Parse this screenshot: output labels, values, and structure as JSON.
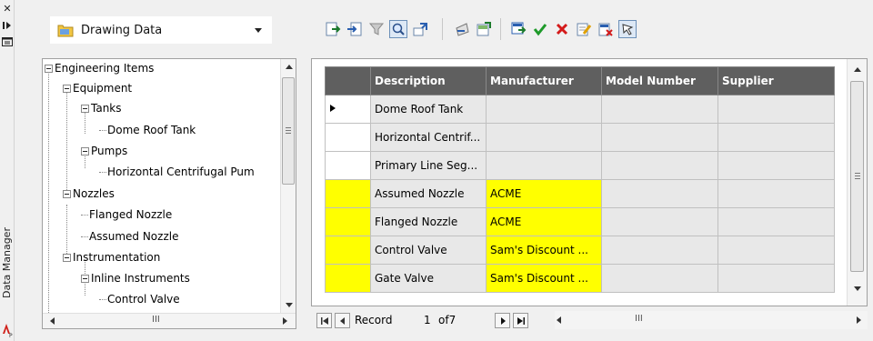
{
  "palette": {
    "header_bg": "#5f5f5f",
    "cell_bg": "#e8e8e8",
    "highlight": "#ffff00"
  },
  "side_strip": {
    "title": "Data Manager",
    "close_icon": "close-icon",
    "pin_icon": "auto-hide-icon",
    "properties_icon": "properties-icon",
    "logo": "autocad-plant3d-logo"
  },
  "toolbar": {
    "selector_value": "Drawing Data",
    "buttons": [
      "export-icon",
      "import-icon",
      "filter-icon",
      "zoom-to-icon",
      "zoom-to-drawing-icon",
      "print-icon",
      "export-report-icon",
      "accept-icon",
      "check-icon",
      "delete-icon",
      "edit-icon",
      "reject-icon",
      "select-icon"
    ]
  },
  "tree": {
    "nodes": [
      {
        "label": "Engineering Items",
        "expandable": true
      },
      {
        "label": "Equipment",
        "expandable": true
      },
      {
        "label": "Tanks",
        "expandable": true
      },
      {
        "label": "Dome Roof Tank",
        "expandable": false
      },
      {
        "label": "Pumps",
        "expandable": true
      },
      {
        "label": "Horizontal Centrifugal Pum",
        "expandable": false
      },
      {
        "label": "Nozzles",
        "expandable": true
      },
      {
        "label": "Flanged Nozzle",
        "expandable": false
      },
      {
        "label": "Assumed Nozzle",
        "expandable": false
      },
      {
        "label": "Instrumentation",
        "expandable": true
      },
      {
        "label": "Inline Instruments",
        "expandable": true
      },
      {
        "label": "Control Valve",
        "expandable": false
      }
    ],
    "hscroll_label": "III"
  },
  "grid": {
    "columns": [
      "Description",
      "Manufacturer",
      "Model Number",
      "Supplier"
    ],
    "rows": [
      {
        "description": "Dome Roof Tank",
        "manufacturer": "",
        "model": "",
        "supplier": "",
        "current": true,
        "highlight": false
      },
      {
        "description": "Horizontal Centrif...",
        "manufacturer": "",
        "model": "",
        "supplier": "",
        "current": false,
        "highlight": false
      },
      {
        "description": "Primary Line Seg...",
        "manufacturer": "",
        "model": "",
        "supplier": "",
        "current": false,
        "highlight": false
      },
      {
        "description": "Assumed Nozzle",
        "manufacturer": "ACME",
        "model": "",
        "supplier": "",
        "current": false,
        "highlight": true
      },
      {
        "description": "Flanged Nozzle",
        "manufacturer": "ACME",
        "model": "",
        "supplier": "",
        "current": false,
        "highlight": true
      },
      {
        "description": "Control Valve",
        "manufacturer": "Sam's Discount ...",
        "model": "",
        "supplier": "",
        "current": false,
        "highlight": true
      },
      {
        "description": "Gate Valve",
        "manufacturer": "Sam's Discount ...",
        "model": "",
        "supplier": "",
        "current": false,
        "highlight": true
      }
    ]
  },
  "record_nav": {
    "label": "Record",
    "position": "1",
    "of_label": "of7",
    "hscroll_label": "III"
  }
}
